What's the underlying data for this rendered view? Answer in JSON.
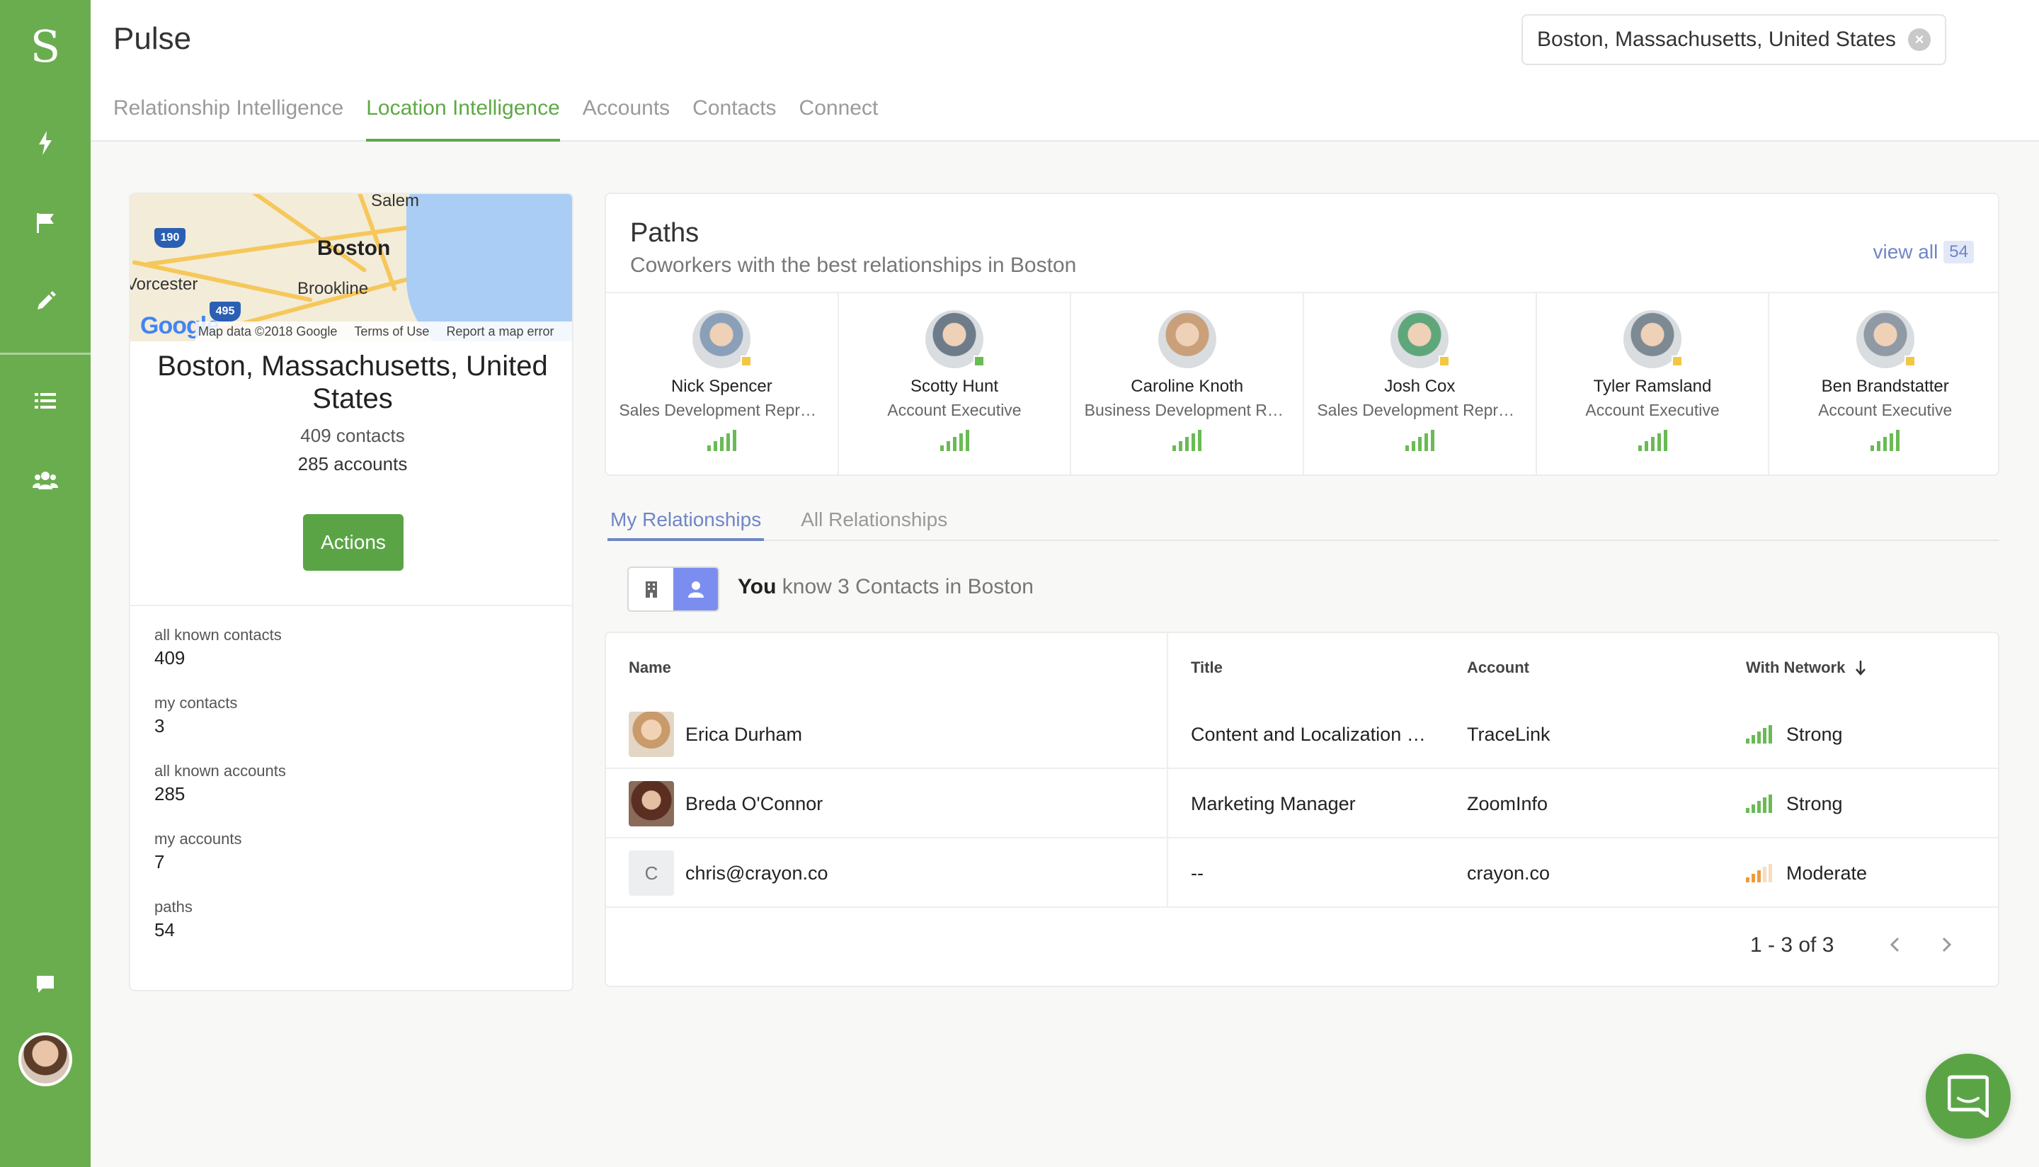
{
  "app": {
    "logo": "S",
    "title": "Pulse"
  },
  "colors": {
    "brand": "#6aad4f",
    "accent": "#6f86c7",
    "strong": "#6aba55",
    "moderate": "#ef9a3c"
  },
  "sidebar": {
    "items": [
      {
        "icon": "bolt-icon"
      },
      {
        "icon": "flag-icon"
      },
      {
        "icon": "pencil-icon"
      },
      {
        "icon": "list-icon"
      },
      {
        "icon": "people-icon"
      }
    ],
    "bottom": [
      {
        "icon": "chat-bubble-icon"
      },
      {
        "icon": "user-avatar"
      }
    ]
  },
  "search": {
    "value": "Boston, Massachusetts, United States"
  },
  "nav": {
    "tabs": [
      {
        "label": "Relationship Intelligence",
        "active": false
      },
      {
        "label": "Location Intelligence",
        "active": true
      },
      {
        "label": "Accounts",
        "active": false
      },
      {
        "label": "Contacts",
        "active": false
      },
      {
        "label": "Connect",
        "active": false
      }
    ]
  },
  "map": {
    "labels": {
      "salem": "Salem",
      "boston": "Boston",
      "worcester": "Vorcester",
      "brookline": "Brookline"
    },
    "shields": {
      "i190": "190",
      "i495": "495"
    },
    "google": "Google",
    "footer": {
      "data": "Map data ©2018 Google",
      "terms": "Terms of Use",
      "report": "Report a map error"
    }
  },
  "location": {
    "name": "Boston, Massachusetts, United States",
    "contacts": "409 contacts",
    "accounts": "285 accounts",
    "actions_label": "Actions",
    "stats": [
      {
        "label": "all known contacts",
        "value": "409"
      },
      {
        "label": "my contacts",
        "value": "3"
      },
      {
        "label": "all known accounts",
        "value": "285"
      },
      {
        "label": "my accounts",
        "value": "7"
      },
      {
        "label": "paths",
        "value": "54"
      }
    ]
  },
  "paths": {
    "title": "Paths",
    "subtitle": "Coworkers with the best relationships in Boston",
    "view_all": "view all",
    "view_all_count": "54",
    "people": [
      {
        "name": "Nick Spencer",
        "title": "Sales Development Representative",
        "avatar_color": "#8aa0b8",
        "strength": "strong"
      },
      {
        "name": "Scotty Hunt",
        "title": "Account Executive",
        "avatar_color": "#6e7c8a",
        "strength": "strong"
      },
      {
        "name": "Caroline Knoth",
        "title": "Business Development Representative",
        "avatar_color": "#c9a07a",
        "strength": "strong"
      },
      {
        "name": "Josh Cox",
        "title": "Sales Development Representative",
        "avatar_color": "#5fa77b",
        "strength": "strong"
      },
      {
        "name": "Tyler Ramsland",
        "title": "Account Executive",
        "avatar_color": "#7d8a93",
        "strength": "strong"
      },
      {
        "name": "Ben Brandstatter",
        "title": "Account Executive",
        "avatar_color": "#8f9aa5",
        "strength": "strong"
      }
    ]
  },
  "relationships": {
    "tabs": [
      {
        "label": "My Relationships",
        "active": true
      },
      {
        "label": "All Relationships",
        "active": false
      }
    ],
    "know_prefix": "You",
    "know_text": " know 3 Contacts in Boston",
    "columns": {
      "name": "Name",
      "title": "Title",
      "account": "Account",
      "network": "With Network"
    },
    "rows": [
      {
        "name": "Erica Durham",
        "title": "Content and Localization …",
        "account": "TraceLink",
        "network": "Strong",
        "strength": "strong",
        "avatar": "#d8b48e",
        "letter": ""
      },
      {
        "name": "Breda O'Connor",
        "title": "Marketing Manager",
        "account": "ZoomInfo",
        "network": "Strong",
        "strength": "strong",
        "avatar": "#6b3d2c",
        "letter": ""
      },
      {
        "name": "chris@crayon.co",
        "title": "--",
        "account": "crayon.co",
        "network": "Moderate",
        "strength": "moderate",
        "avatar": "",
        "letter": "C"
      }
    ],
    "pager": "1 - 3 of 3"
  }
}
